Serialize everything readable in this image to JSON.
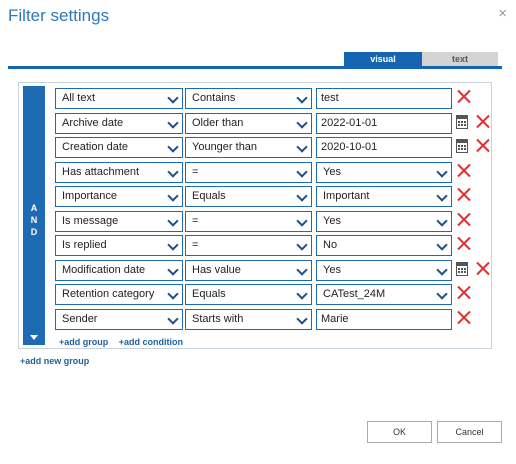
{
  "dialog": {
    "title": "Filter settings",
    "close_glyph": "×"
  },
  "tabs": [
    {
      "label": "visual",
      "active": true
    },
    {
      "label": "text",
      "active": false
    }
  ],
  "group": {
    "operator": "AND"
  },
  "rows": [
    {
      "field": "All text",
      "operator": "Contains",
      "value": "test",
      "value_type": "text",
      "calendar": false
    },
    {
      "field": "Archive date",
      "operator": "Older than",
      "value": "2022-01-01",
      "value_type": "text",
      "calendar": true
    },
    {
      "field": "Creation date",
      "operator": "Younger than",
      "value": "2020-10-01",
      "value_type": "text",
      "calendar": true
    },
    {
      "field": "Has attachment",
      "operator": "=",
      "value": "Yes",
      "value_type": "select",
      "calendar": false
    },
    {
      "field": "Importance",
      "operator": "Equals",
      "value": "Important",
      "value_type": "select",
      "calendar": false
    },
    {
      "field": "Is message",
      "operator": "=",
      "value": "Yes",
      "value_type": "select",
      "calendar": false
    },
    {
      "field": "Is replied",
      "operator": "=",
      "value": "No",
      "value_type": "select",
      "calendar": false
    },
    {
      "field": "Modification date",
      "operator": "Has value",
      "value": "Yes",
      "value_type": "select",
      "calendar": true
    },
    {
      "field": "Retention category",
      "operator": "Equals",
      "value": "CATest_24M",
      "value_type": "select",
      "calendar": false
    },
    {
      "field": "Sender",
      "operator": "Starts with",
      "value": "Marie",
      "value_type": "text",
      "calendar": false
    }
  ],
  "links": {
    "add_group": "+add group",
    "add_condition": "+add condition",
    "add_new_group": "+add new group"
  },
  "buttons": {
    "ok": "OK",
    "cancel": "Cancel"
  },
  "colors": {
    "accent": "#1f6bb3",
    "title": "#2f79b9",
    "delete": "#e03030"
  }
}
